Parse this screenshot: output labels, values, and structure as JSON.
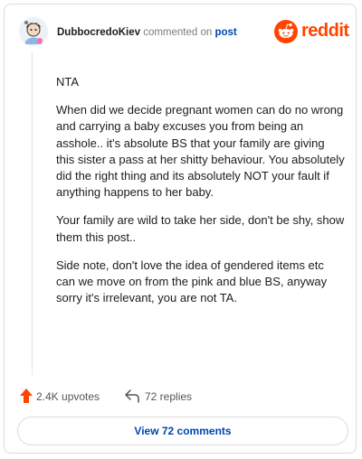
{
  "comment": {
    "username": "DubbocredoKiev",
    "action_text": " commented on ",
    "post_link": "post",
    "paragraphs": [
      "NTA",
      "When did we decide pregnant women can do no wrong and carrying a baby excuses you from being an asshole.. it's absolute BS that your family are giving this sister a pass at her shitty behaviour. You absolutely did the right thing and its absolutely NOT your fault if anything happens to her baby.",
      "Your family are wild to take her side, don't be shy, show them this post..",
      "Side note, don't love the idea of gendered items etc can we move on from the pink and blue BS, anyway sorry it's irrelevant, you are not TA."
    ]
  },
  "brand": {
    "name": "reddit",
    "color": "#ff4500",
    "icon": "reddit-logo-icon"
  },
  "stats": {
    "upvotes_label": "2.4K upvotes",
    "replies_label": "72 replies"
  },
  "view_button_label": "View 72 comments",
  "colors": {
    "accent": "#ff4500",
    "link": "#0045ac"
  }
}
